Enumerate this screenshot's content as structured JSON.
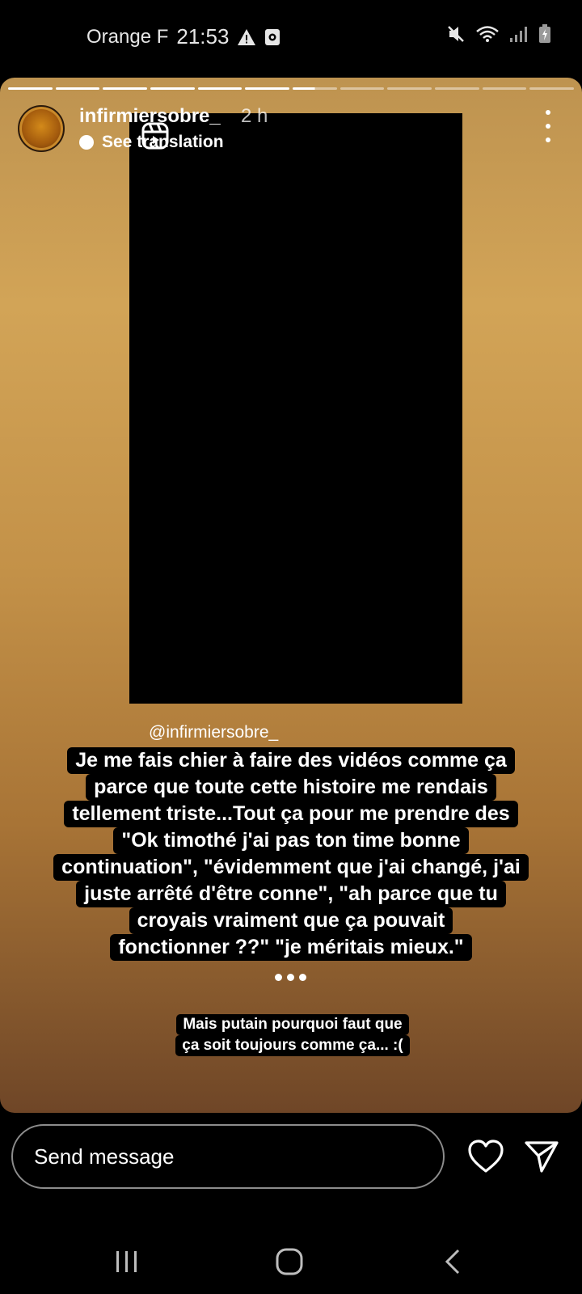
{
  "status_bar": {
    "carrier": "Orange F",
    "time": "21:53",
    "left_icons": [
      "warning-icon",
      "notification-icon"
    ],
    "right_icons": [
      "mute-icon",
      "wifi-icon",
      "signal-icon",
      "battery-icon"
    ]
  },
  "story": {
    "progress": {
      "total_segments": 12,
      "completed": 6,
      "current_fill": 0.5
    },
    "username": "infirmiersobre_",
    "timestamp": "2 h",
    "translate_label": "See translation",
    "mention": "@infirmiersobre_",
    "caption_lines": [
      "Je me fais chier à faire des vidéos comme ça",
      "parce que toute cette histoire me rendais",
      "tellement triste...Tout ça pour me prendre des",
      "\"Ok timothé j'ai pas ton time bonne",
      "continuation\", \"évidemment que j'ai changé, j'ai",
      "juste arrêté d'être conne\", \"ah parce que tu",
      "croyais vraiment que ça pouvait",
      "fonctionner ??\" \"je méritais mieux.\""
    ],
    "note_lines": [
      "Mais putain pourquoi faut que",
      "ça soit toujours comme ça... :("
    ],
    "colors": {
      "gradient_top": "#be9350",
      "gradient_mid": "#d2a457",
      "gradient_bottom": "#6f4627"
    }
  },
  "message_bar": {
    "placeholder": "Send message",
    "icons": [
      "heart-icon",
      "send-icon"
    ]
  },
  "nav_bar": {
    "icons": [
      "recent-apps-icon",
      "home-icon",
      "back-icon"
    ]
  }
}
